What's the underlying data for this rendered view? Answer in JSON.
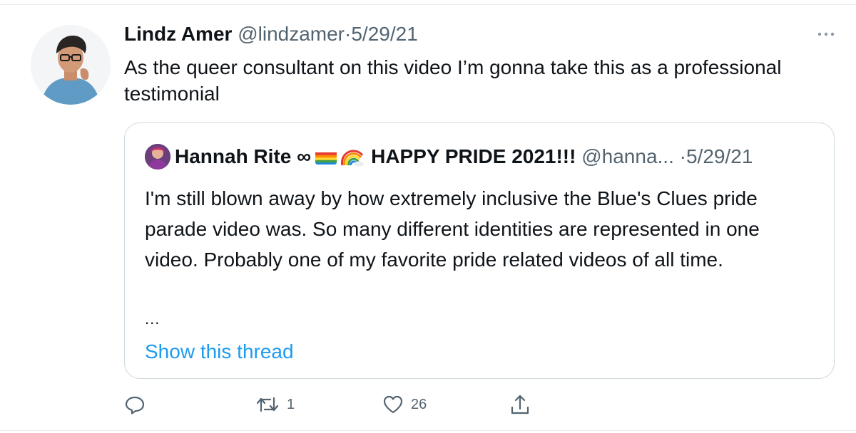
{
  "tweet": {
    "author_name": "Lindz Amer",
    "handle": "@lindzamer",
    "separator": "·",
    "date": "5/29/21",
    "text": "As the queer consultant on this video I’m gonna take this as a professional testimonial"
  },
  "quoted_tweet": {
    "author_name": "Hannah Rite ∞",
    "name_suffix": "HAPPY PRIDE 2021!!!",
    "handle": "@hanna...",
    "separator": "·",
    "date": "5/29/21",
    "text": "I'm still blown away by how extremely inclusive the Blue's Clues pride parade video was. So many different identities are represented in one video. Probably one of my favorite pride related videos of all time.",
    "ellipsis": "...",
    "show_thread_label": "Show this thread"
  },
  "actions": {
    "reply_count": "",
    "retweet_count": "1",
    "like_count": "26"
  },
  "icons": {
    "more": "more-horizontal-icon",
    "reply": "reply-icon",
    "retweet": "retweet-icon",
    "like": "heart-icon",
    "share": "share-icon",
    "flag": "rainbow-flag-emoji",
    "rainbow": "rainbow-emoji"
  },
  "colors": {
    "link": "#1d9bf0",
    "secondary_text": "#536471",
    "border": "#cfd9de"
  }
}
